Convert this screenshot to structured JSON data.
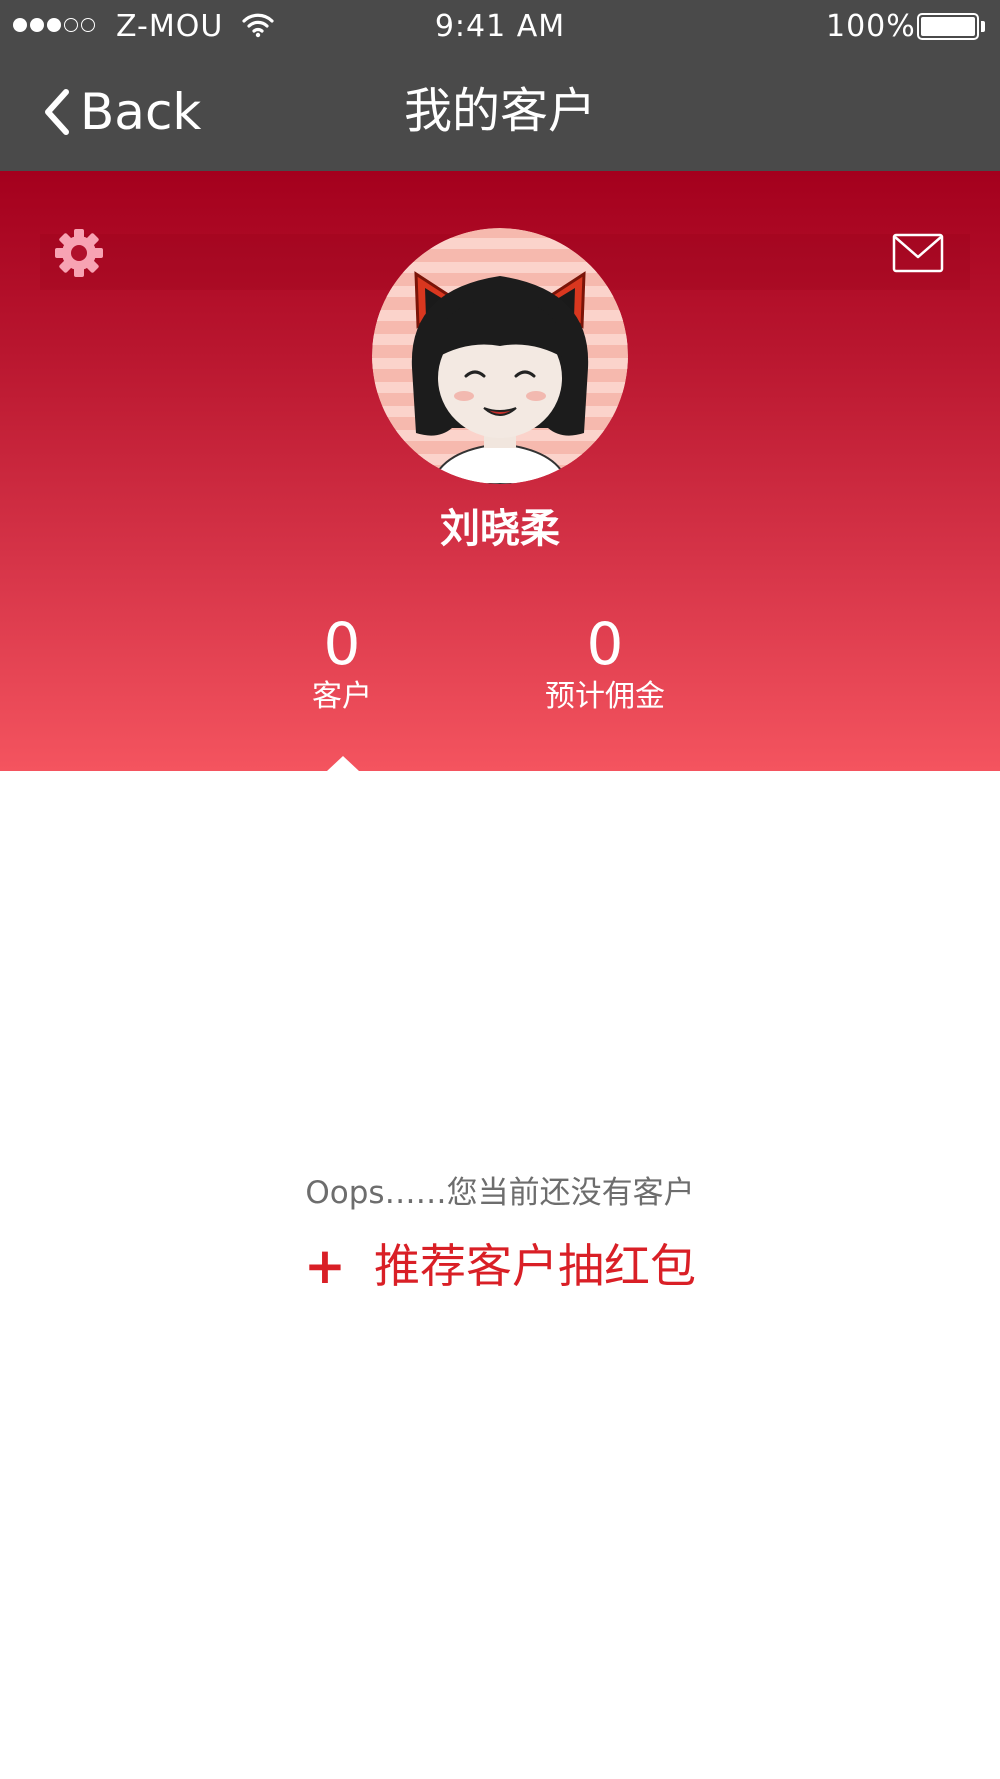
{
  "status_bar": {
    "carrier": "Z-MOU",
    "time": "9:41 AM",
    "battery": "100%",
    "signal_strength": 3,
    "signal_bars": 5
  },
  "nav": {
    "back_label": "Back",
    "title": "我的客户"
  },
  "profile": {
    "name": "刘晓柔"
  },
  "stats": {
    "customers": {
      "value": "0",
      "label": "客户"
    },
    "commission": {
      "value": "0",
      "label": "预计佣金"
    }
  },
  "empty_state": {
    "message": "Oops……您当前还没有客户",
    "plus": "+",
    "action": "推荐客户抽红包"
  },
  "colors": {
    "nav_bg": "#4a4a4a",
    "header_top": "#a4001d",
    "header_bottom": "#f4545f",
    "accent": "#d91f26",
    "gear": "#f7a3b3"
  },
  "icons": {
    "back": "chevron-left-icon",
    "settings": "gear-icon",
    "messages": "envelope-icon",
    "wifi": "wifi-icon",
    "battery": "battery-icon"
  }
}
